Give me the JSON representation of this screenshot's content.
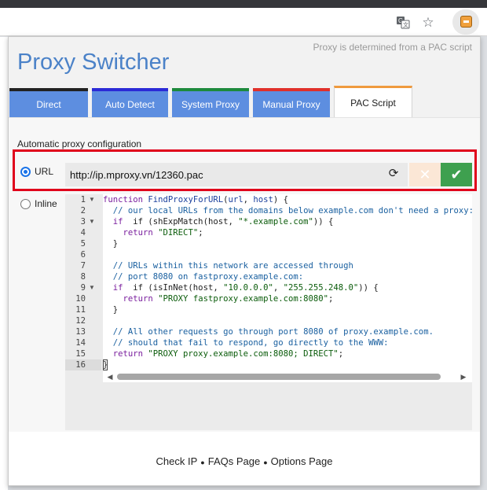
{
  "browser": {
    "icons": [
      "translate-icon",
      "bookmark-star-icon",
      "extension-icon"
    ]
  },
  "popup": {
    "title": "Proxy Switcher",
    "header_note": "Proxy is determined from a PAC script",
    "tabs": [
      {
        "label": "Direct",
        "accent": "#222222"
      },
      {
        "label": "Auto Detect",
        "accent": "#2b2ad6"
      },
      {
        "label": "System Proxy",
        "accent": "#1e8a3c"
      },
      {
        "label": "Manual Proxy",
        "accent": "#e0302a"
      },
      {
        "label": "PAC Script",
        "accent": "#ef9a3e",
        "active": true
      }
    ],
    "section_label": "Automatic proxy configuration",
    "url_option_label": "URL",
    "inline_option_label": "Inline",
    "url_value": "http://ip.mproxy.vn/12360.pac",
    "cancel_symbol": "✕",
    "apply_symbol": "✔",
    "refresh_symbol": "⟳",
    "editor_lines": [
      "1",
      "2",
      "3",
      "4",
      "5",
      "6",
      "7",
      "8",
      "9",
      "10",
      "11",
      "12",
      "13",
      "14",
      "15",
      "16"
    ],
    "code": {
      "l1": "function FindProxyForURL(url, host) {",
      "l2": "  // our local URLs from the domains below example.com don't need a proxy:",
      "l3a": "  if (shExpMatch(host, ",
      "l3b": "\"*.example.com\"",
      "l3c": ")) {",
      "l4a": "    return ",
      "l4b": "\"DIRECT\"",
      "l4c": ";",
      "l5": "  }",
      "l7": "  // URLs within this network are accessed through",
      "l8": "  // port 8080 on fastproxy.example.com:",
      "l9a": "  if (isInNet(host, ",
      "l9b": "\"10.0.0.0\"",
      "l9c": ", ",
      "l9d": "\"255.255.248.0\"",
      "l9e": ")) {",
      "l10a": "    return ",
      "l10b": "\"PROXY fastproxy.example.com:8080\"",
      "l10c": ";",
      "l11": "  }",
      "l13": "  // All other requests go through port 8080 of proxy.example.com.",
      "l14": "  // should that fail to respond, go directly to the WWW:",
      "l15a": "  return ",
      "l15b": "\"PROXY proxy.example.com:8080; DIRECT\"",
      "l15c": ";",
      "l16": "}"
    },
    "footer": {
      "check_ip": "Check IP",
      "faqs": "FAQs Page",
      "options": "Options Page",
      "separator": "●"
    }
  }
}
